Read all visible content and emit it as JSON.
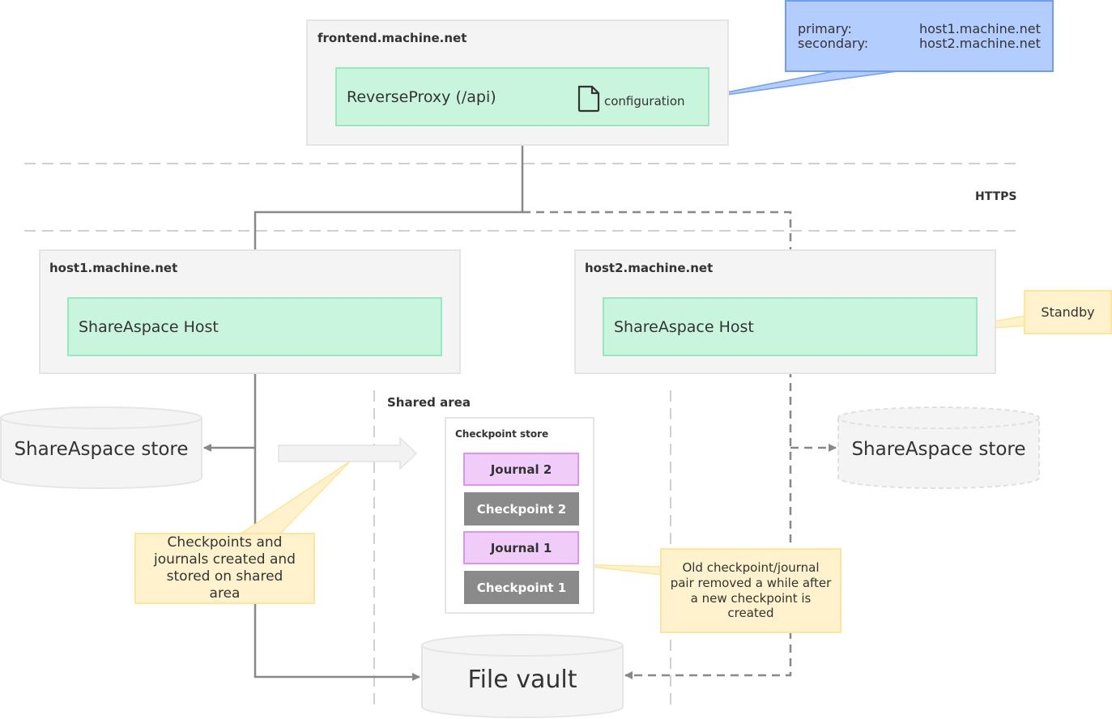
{
  "frontend": {
    "title": "frontend.machine.net",
    "proxy_label": "ReverseProxy (/api)",
    "config_label": "configuration",
    "config_callout": {
      "rows": [
        {
          "key": "primary:",
          "value": "host1.machine.net"
        },
        {
          "key": "secondary:",
          "value": "host2.machine.net"
        }
      ]
    }
  },
  "protocol_label": "HTTPS",
  "host1": {
    "title": "host1.machine.net",
    "service_label": "ShareAspace Host",
    "store_label": "ShareAspace store"
  },
  "host2": {
    "title": "host2.machine.net",
    "service_label": "ShareAspace Host",
    "store_label": "ShareAspace store",
    "status_callout": "Standby"
  },
  "shared_area": {
    "title": "Shared area",
    "checkpoint_store": {
      "title": "Checkpoint store",
      "items": [
        {
          "label": "Journal 2",
          "kind": "journal"
        },
        {
          "label": "Checkpoint 2",
          "kind": "checkpoint"
        },
        {
          "label": "Journal 1",
          "kind": "journal"
        },
        {
          "label": "Checkpoint 1",
          "kind": "checkpoint"
        }
      ]
    }
  },
  "file_vault_label": "File vault",
  "callouts": {
    "created": "Checkpoints and journals created and stored on shared area",
    "removed": "Old checkpoint/journal pair removed a while after a new checkpoint is created"
  },
  "colors": {
    "group_fill": "#f4f4f4",
    "service_fill": "#c9f5de",
    "service_border": "#96e8bd",
    "journal_fill": "#f0ccf9",
    "checkpoint_fill": "#8a8a8a",
    "note_fill": "#fff2cc",
    "config_fill": "#b3cdfe",
    "wire": "#888888"
  }
}
